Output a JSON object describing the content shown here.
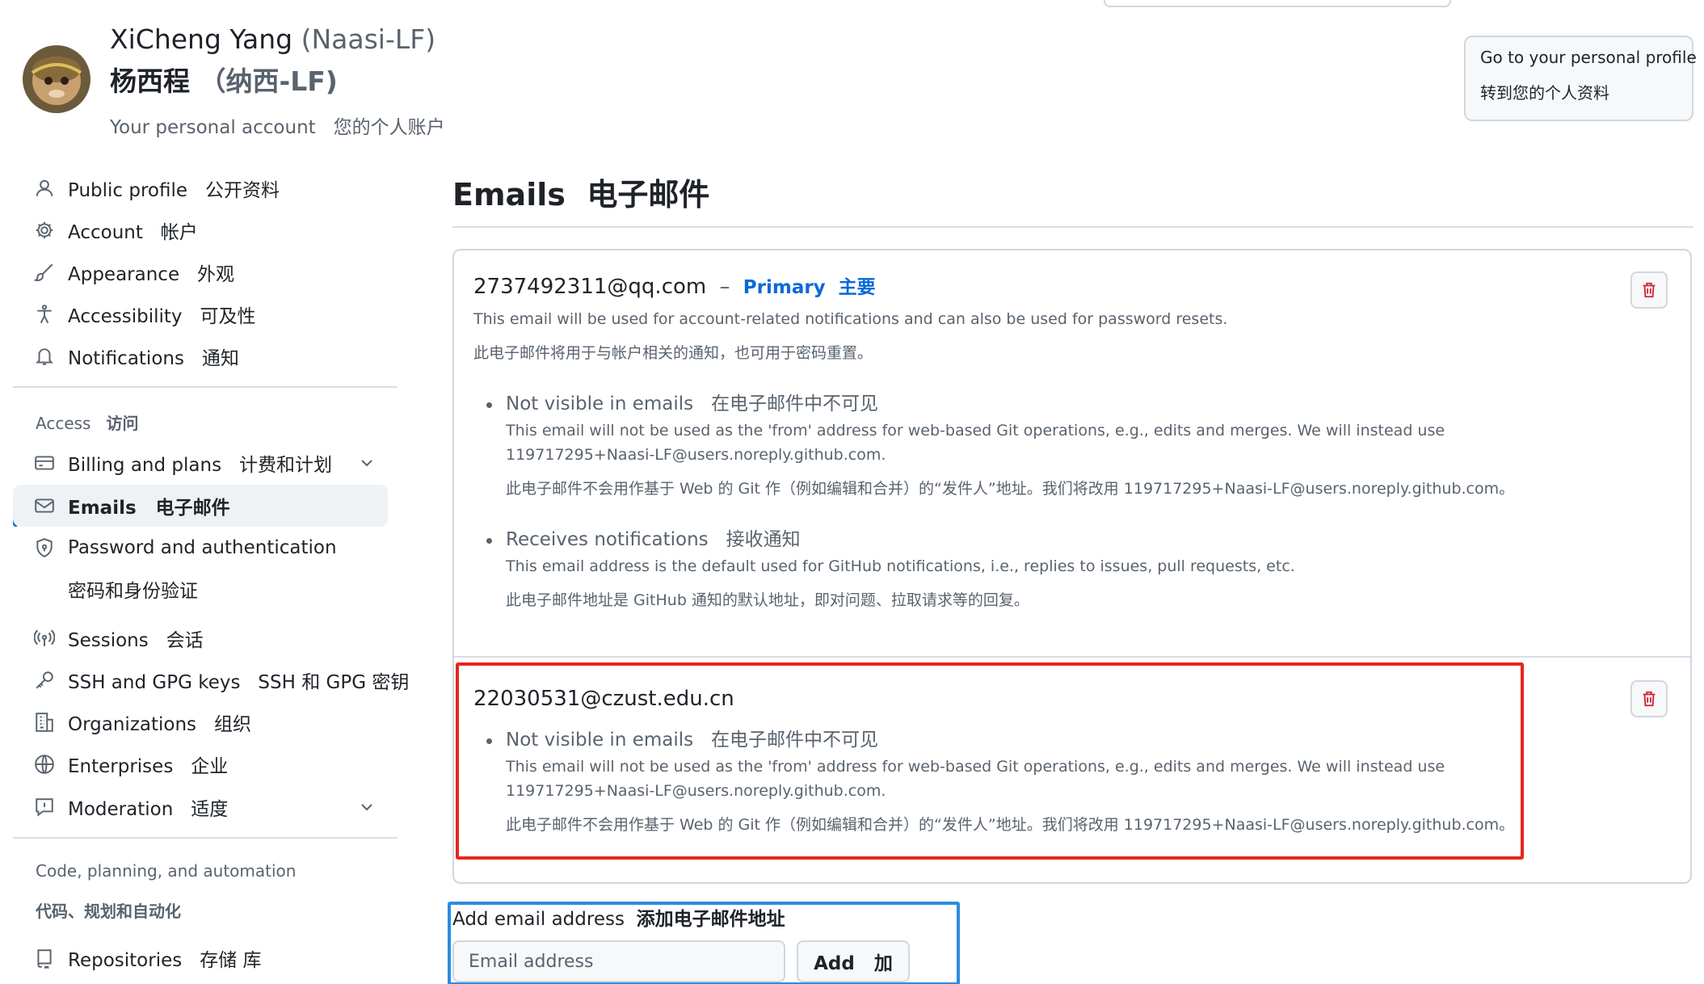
{
  "header": {
    "name": "XiCheng Yang",
    "login": "(Naasi-LF)",
    "name_cn": "杨西程",
    "login_cn": "（纳西-LF)",
    "subtitle": "Your personal account   您的个人账户",
    "profile_button_en": "Go to your personal profile",
    "profile_button_cn": "转到您的个人资料"
  },
  "sidebar": {
    "items": [
      {
        "label": "Public profile   公开资料",
        "icon": "person-icon"
      },
      {
        "label": "Account   帐户",
        "icon": "gear-icon"
      },
      {
        "label": "Appearance   外观",
        "icon": "paintbrush-icon"
      },
      {
        "label": "Accessibility   可及性",
        "icon": "accessibility-icon"
      },
      {
        "label": "Notifications   通知",
        "icon": "bell-icon"
      }
    ],
    "access_heading": "Access",
    "access_heading_cn": "访问",
    "access_items": [
      {
        "label": "Billing and plans   计费和计划",
        "icon": "credit-card-icon"
      },
      {
        "label": "Emails   电子邮件",
        "icon": "mail-icon"
      },
      {
        "label": "Password and authentication",
        "icon": "shield-lock-icon",
        "sub": "密码和身份验证"
      },
      {
        "label": "Sessions   会话",
        "icon": "broadcast-icon"
      },
      {
        "label": "SSH and GPG keys   SSH 和 GPG 密钥",
        "icon": "key-icon"
      },
      {
        "label": "Organizations   组织",
        "icon": "organization-icon"
      },
      {
        "label": "Enterprises   企业",
        "icon": "globe-icon"
      },
      {
        "label": "Moderation   适度",
        "icon": "report-icon"
      }
    ],
    "code_heading": "Code, planning, and automation",
    "code_heading_cn": "代码、规划和自动化",
    "repositories": "Repositories   存储 库"
  },
  "main": {
    "title": "Emails  电子邮件",
    "emails": [
      {
        "address": "2737492311@qq.com",
        "dash": "–",
        "primary": "Primary  主要",
        "desc_en": "This email will be used for account-related notifications and can also be used for password resets.",
        "desc_cn": "此电子邮件将用于与帐户相关的通知，也可用于密码重置。",
        "bullets": [
          {
            "title": "Not visible in emails   在电子邮件中不可见",
            "desc_en": "This email will not be used as the 'from' address for web-based Git operations, e.g., edits and merges. We will instead use 119717295+Naasi-LF@users.noreply.github.com.",
            "desc_cn": "此电子邮件不会用作基于 Web 的 Git 作（例如编辑和合并）的“发件人”地址。我们将改用 119717295+Naasi-LF@users.noreply.github.com。"
          },
          {
            "title": "Receives notifications   接收通知",
            "desc_en": "This email address is the default used for GitHub notifications, i.e., replies to issues, pull requests, etc.",
            "desc_cn": "此电子邮件地址是 GitHub 通知的默认地址，即对问题、拉取请求等的回复。"
          }
        ]
      },
      {
        "address": "22030531@czust.edu.cn",
        "bullets": [
          {
            "title": "Not visible in emails   在电子邮件中不可见",
            "desc_en": "This email will not be used as the 'from' address for web-based Git operations, e.g., edits and merges. We will instead use 119717295+Naasi-LF@users.noreply.github.com.",
            "desc_cn": "此电子邮件不会用作基于 Web 的 Git 作（例如编辑和合并）的“发件人”地址。我们将改用 119717295+Naasi-LF@users.noreply.github.com。"
          }
        ]
      }
    ],
    "add_label": "Add email address",
    "add_label_cn": "添加电子邮件地址",
    "email_placeholder": "Email address",
    "add_button": "Add   加"
  },
  "colors": {
    "accent": "#0969da",
    "danger": "#cf222e",
    "highlight_red": "#e5261f",
    "highlight_blue": "#2d8be0"
  }
}
